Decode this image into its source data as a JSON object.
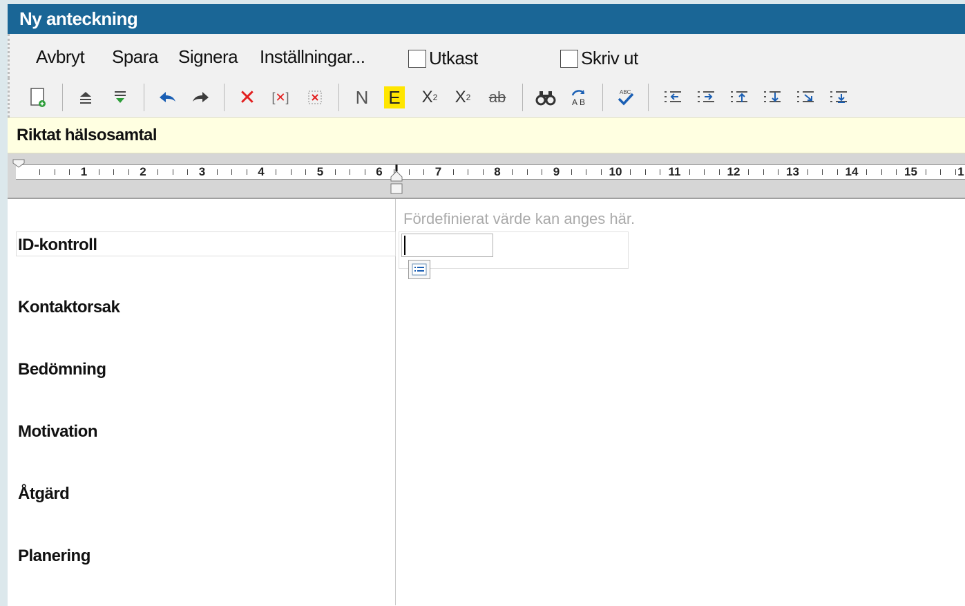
{
  "window": {
    "title": "Ny anteckning"
  },
  "menu": {
    "cancel": "Avbryt",
    "save": "Spara",
    "sign": "Signera",
    "settings": "Inställningar...",
    "draft_label": "Utkast",
    "draft_checked": false,
    "print_label": "Skriv ut",
    "print_checked": false
  },
  "toolbar": {
    "icons": [
      "new-page-icon",
      "collapse-icon",
      "expand-icon",
      "undo-icon",
      "redo-icon",
      "delete-icon",
      "delete-bracket-icon",
      "delete-box-icon",
      "normal-text-icon",
      "highlight-icon",
      "superscript-icon",
      "subscript-icon",
      "strikethrough-icon",
      "find-icon",
      "replace-icon",
      "spellcheck-icon",
      "indent-left-icon",
      "indent-right-icon",
      "move-up-icon",
      "move-down-icon",
      "move-top-icon",
      "move-bottom-icon"
    ],
    "normal_glyph": "N",
    "highlight_glyph": "E",
    "highlight_color": "#ffe600",
    "undo_color": "#1a5fb4",
    "delete_color": "#e21f1f"
  },
  "section": {
    "title": "Riktat hälsosamtal"
  },
  "ruler": {
    "numbers": [
      "1",
      "2",
      "3",
      "4",
      "5",
      "6",
      "7",
      "8",
      "9",
      "10",
      "11",
      "12",
      "13",
      "14",
      "15",
      "1"
    ]
  },
  "form": {
    "hint": "Fördefinierat värde kan anges här.",
    "id_value": "",
    "labels": [
      "ID-kontroll",
      "Kontaktorsak",
      "Bedömning",
      "Motivation",
      "Åtgärd",
      "Planering"
    ]
  },
  "colors": {
    "titlebar": "#1a6696",
    "section_bg": "#ffffe1"
  }
}
